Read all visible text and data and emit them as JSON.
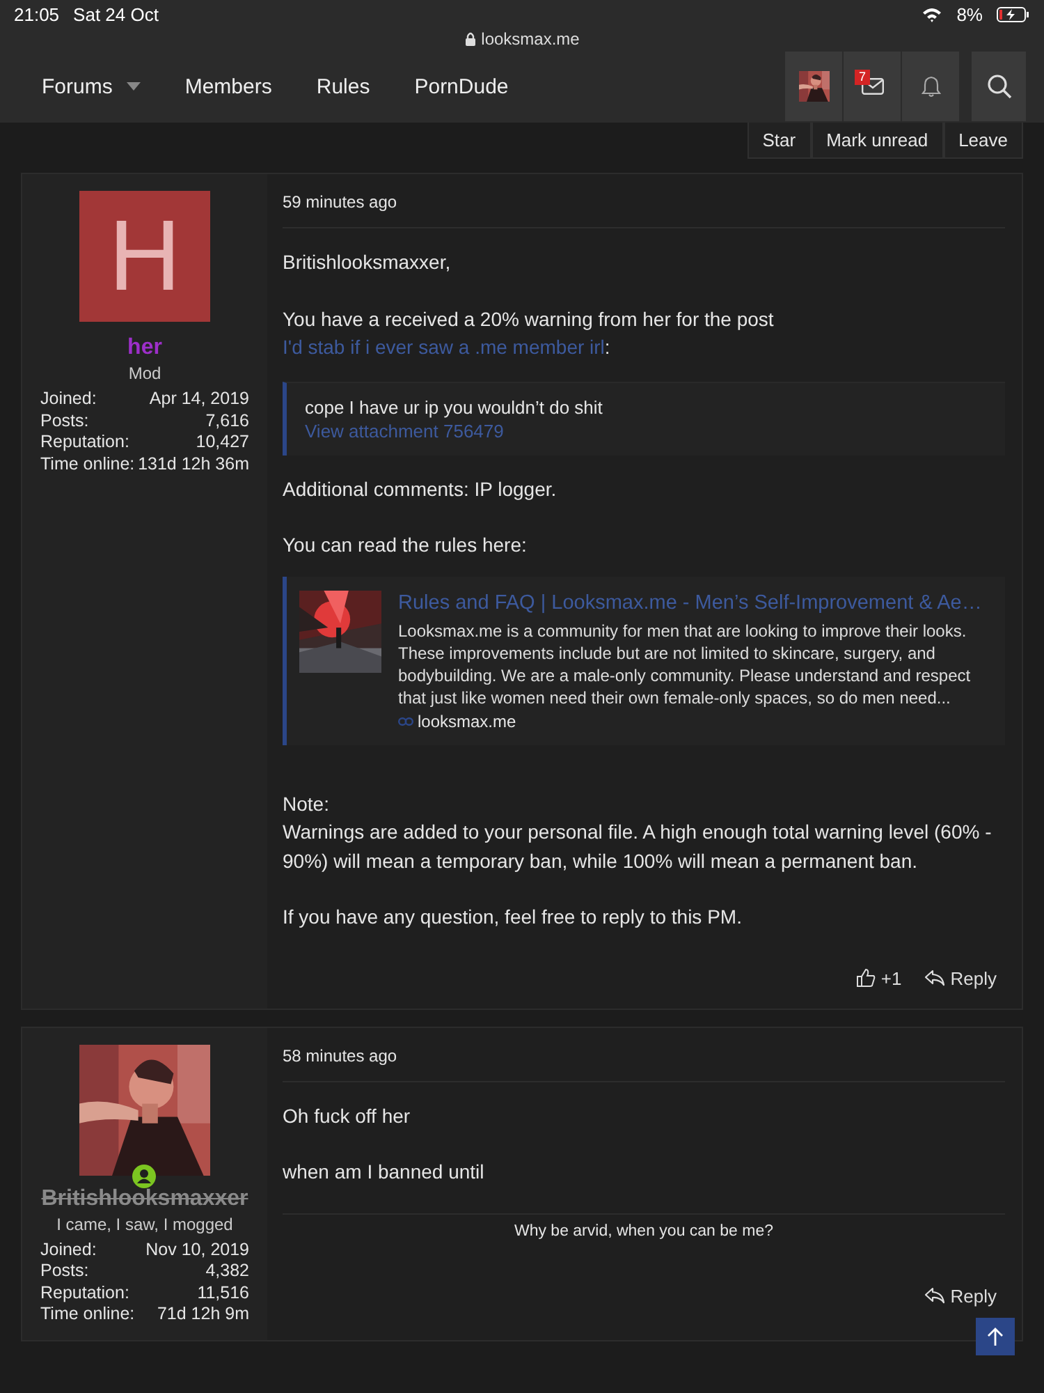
{
  "status_bar": {
    "time": "21:05",
    "date": "Sat 24 Oct",
    "battery": "8%"
  },
  "url_bar": {
    "domain": "looksmax.me"
  },
  "nav": {
    "items": [
      {
        "label": "Forums",
        "has_menu": true
      },
      {
        "label": "Members",
        "has_menu": false
      },
      {
        "label": "Rules",
        "has_menu": false
      },
      {
        "label": "PornDude",
        "has_menu": false
      }
    ],
    "inbox_count": "7"
  },
  "conversation_actions": [
    "Star",
    "Mark unread",
    "Leave"
  ],
  "posts": [
    {
      "user": {
        "avatar": {
          "kind": "letter",
          "letter": "H",
          "color": "#a23737"
        },
        "name": "her",
        "color": "#9d2fc9",
        "struck": false,
        "online": false,
        "title": "Mod",
        "stats": [
          {
            "label": "Joined:",
            "value": "Apr 14, 2019"
          },
          {
            "label": "Posts:",
            "value": "7,616"
          },
          {
            "label": "Reputation:",
            "value": "10,427"
          },
          {
            "label": "Time online:",
            "value": "131d 12h 36m"
          }
        ]
      },
      "time": "59 minutes ago",
      "blocks": [
        {
          "kind": "text",
          "lines": [
            "Britishlooksmaxxer,"
          ]
        },
        {
          "kind": "linked_text",
          "before": "You have a received a 20% warning from her for the post ",
          "link": "I'd stab if i ever saw a .me member irl",
          "after": ":"
        },
        {
          "kind": "quote",
          "text": "cope I have ur ip you wouldn’t do shit",
          "link": "View attachment 756479"
        },
        {
          "kind": "text",
          "lines": [
            "Additional comments: IP logger."
          ]
        },
        {
          "kind": "text",
          "lines": [
            "You can read the rules here:"
          ]
        },
        {
          "kind": "preview",
          "title": "Rules and FAQ | Looksmax.me - Men’s Self-Improvement & Ae…",
          "description": "Looksmax.me is a community for men that are looking to improve their looks. These improvements include but are not limited to skincare, surgery, and bodybuilding. We are a male-only community. Please understand and respect that just like women need their own female-only spaces, so do men need...",
          "domain": "looksmax.me"
        },
        {
          "kind": "text",
          "lines": [
            "Note:",
            "Warnings are added to your personal file. A high enough total warning level (60% - 90%) will mean a temporary ban, while 100% will mean a permanent ban."
          ]
        },
        {
          "kind": "text",
          "lines": [
            "If you have any question, feel free to reply to this PM."
          ]
        }
      ],
      "actions": [
        {
          "kind": "like",
          "label": "+1"
        },
        {
          "kind": "reply",
          "label": "Reply"
        }
      ]
    },
    {
      "user": {
        "name": "Britishlooksmaxxer",
        "color": "#8a8a8a",
        "struck": true,
        "online": true,
        "title": "I came, I saw, I mogged",
        "stats": [
          {
            "label": "Joined:",
            "value": "Nov 10, 2019"
          },
          {
            "label": "Posts:",
            "value": "4,382"
          },
          {
            "label": "Reputation:",
            "value": "11,516"
          },
          {
            "label": "Time online:",
            "value": "71d 12h 9m"
          }
        ]
      },
      "time": "58 minutes ago",
      "blocks": [
        {
          "kind": "text",
          "lines": [
            "Oh fuck off her"
          ]
        },
        {
          "kind": "text",
          "lines": [
            "when am I banned until"
          ]
        }
      ],
      "signature": "Why be arvid, when you can be me?",
      "actions": [
        {
          "kind": "reply",
          "label": "Reply"
        }
      ]
    }
  ]
}
